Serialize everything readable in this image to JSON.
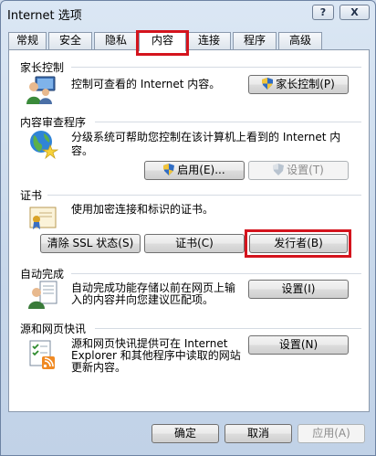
{
  "window": {
    "title": "Internet 选项",
    "help_glyph": "?",
    "close_glyph": "X"
  },
  "tabs": [
    {
      "label": "常规"
    },
    {
      "label": "安全"
    },
    {
      "label": "隐私"
    },
    {
      "label": "内容"
    },
    {
      "label": "连接"
    },
    {
      "label": "程序"
    },
    {
      "label": "高级"
    }
  ],
  "active_tab": "内容",
  "highlight_color": "#d4141d",
  "groups": {
    "parental": {
      "title": "家长控制",
      "text": "控制可查看的 Internet 内容。",
      "button": "家长控制(P)",
      "icon": "parental-users-icon"
    },
    "advisor": {
      "title": "内容审查程序",
      "text_line1": "分级系统可帮助您控制在该计算机上看到的 Internet 内",
      "text_line2": "容。",
      "enable_button": "启用(E)...",
      "settings_button": "设置(T)",
      "icon": "globe-rating-icon"
    },
    "certificates": {
      "title": "证书",
      "text": "使用加密连接和标识的证书。",
      "clear_ssl_button": "清除 SSL 状态(S)",
      "certs_button": "证书(C)",
      "publishers_button": "发行者(B)",
      "icon": "certificate-icon"
    },
    "autocomplete": {
      "title": "自动完成",
      "text_line1": "自动完成功能存储以前在网页上输",
      "text_line2": "入的内容并向您建议匹配项。",
      "settings_button": "设置(I)",
      "icon": "autocomplete-user-icon"
    },
    "feeds": {
      "title": "源和网页快讯",
      "text_line1": "源和网页快讯提供可在 Internet",
      "text_line2": "Explorer 和其他程序中读取的网站",
      "text_line3": "更新内容。",
      "settings_button": "设置(N)",
      "icon": "rss-feed-icon"
    }
  },
  "footer": {
    "ok": "确定",
    "cancel": "取消",
    "apply": "应用(A)"
  }
}
